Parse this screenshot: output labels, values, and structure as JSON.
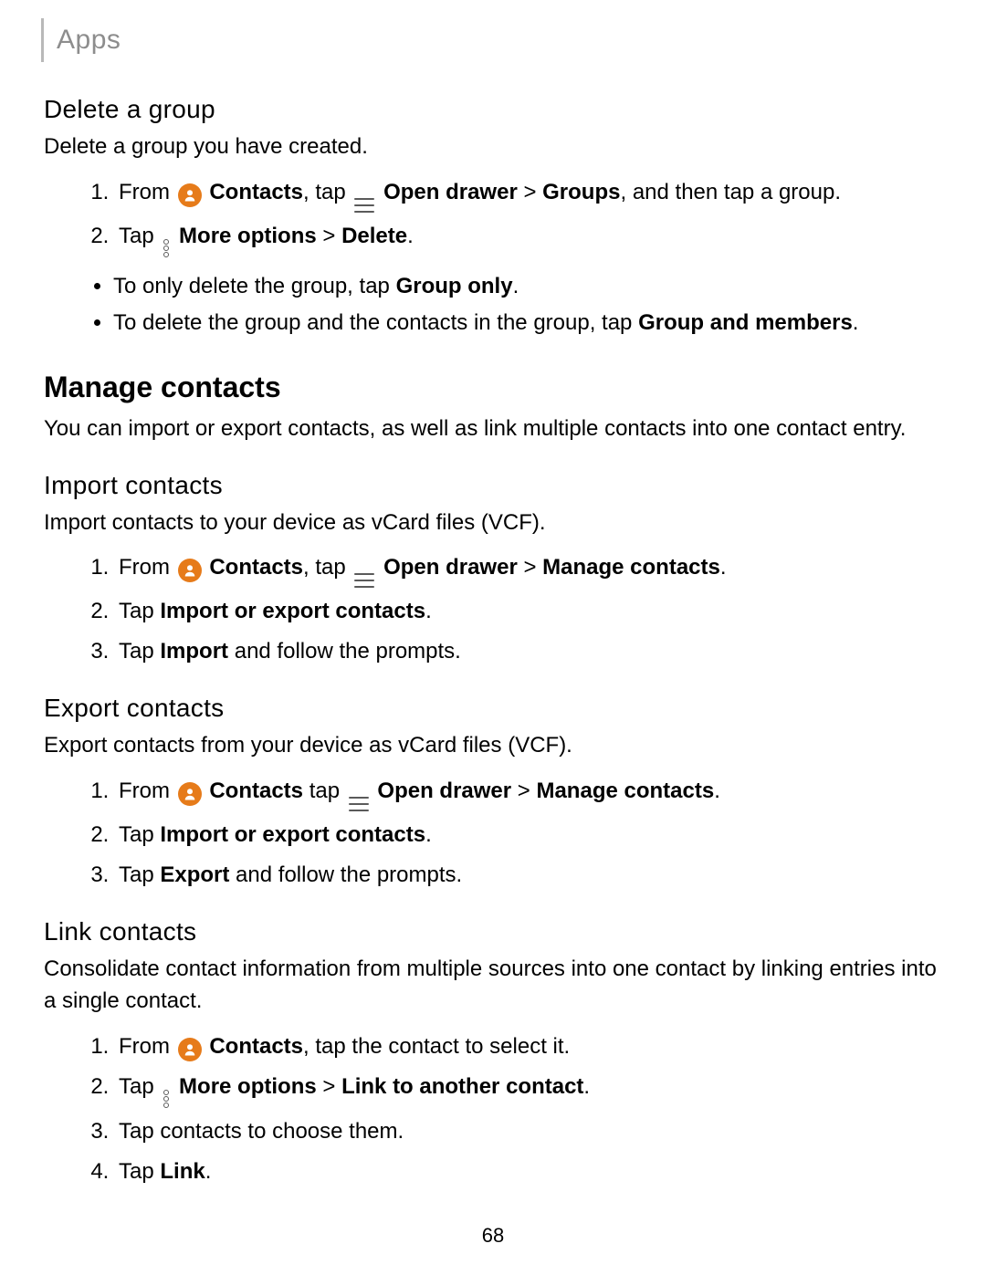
{
  "breadcrumb": "Apps",
  "page_number": "68",
  "delete_group": {
    "heading": "Delete a group",
    "intro": "Delete a group you have created.",
    "step1": {
      "from": "From",
      "contacts": " Contacts",
      "tap": ", tap",
      "open_drawer": " Open drawer",
      "groups": "Groups",
      "tail": ", and then tap a group."
    },
    "step2": {
      "tap": "Tap",
      "more_options": " More options",
      "delete": "Delete",
      "dot": "."
    },
    "bullet1_pre": "To only delete the group, tap ",
    "bullet1_bold": "Group only",
    "bullet1_post": ".",
    "bullet2_pre": "To delete the group and the contacts in the group, tap ",
    "bullet2_bold": "Group and members",
    "bullet2_post": "."
  },
  "manage": {
    "heading": "Manage contacts",
    "intro": "You can import or export contacts, as well as link multiple contacts into one contact entry."
  },
  "import": {
    "heading": "Import contacts",
    "intro": "Import contacts to your device as vCard files (VCF).",
    "step1": {
      "from": "From",
      "contacts": " Contacts",
      "tap": ", tap",
      "open_drawer": " Open drawer",
      "manage": "Manage contacts",
      "dot": "."
    },
    "step2_pre": "Tap ",
    "step2_bold": "Import or export contacts",
    "step2_post": ".",
    "step3_pre": "Tap ",
    "step3_bold": "Import",
    "step3_post": " and follow the prompts."
  },
  "export": {
    "heading": "Export contacts",
    "intro": "Export contacts from your device as vCard files (VCF).",
    "step1": {
      "from": "From",
      "contacts": " Contacts",
      "tap": " tap",
      "open_drawer": " Open drawer",
      "manage": "Manage contacts",
      "dot": "."
    },
    "step2_pre": "Tap ",
    "step2_bold": "Import or export contacts",
    "step2_post": ".",
    "step3_pre": "Tap ",
    "step3_bold": "Export",
    "step3_post": " and follow the prompts."
  },
  "link": {
    "heading": "Link contacts",
    "intro": "Consolidate contact information from multiple sources into one contact by linking entries into a single contact.",
    "step1": {
      "from": "From",
      "contacts": " Contacts",
      "tail": ", tap the contact to select it."
    },
    "step2": {
      "tap": "Tap",
      "more_options": " More options",
      "link": "Link to another contact",
      "dot": "."
    },
    "step3": "Tap contacts to choose them.",
    "step4_pre": "Tap ",
    "step4_bold": "Link",
    "step4_post": "."
  }
}
